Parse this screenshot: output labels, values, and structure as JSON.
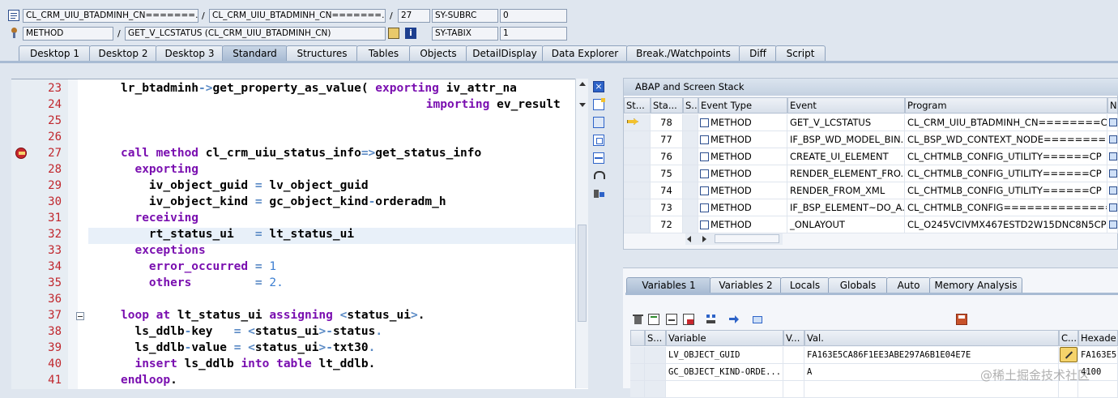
{
  "header": {
    "row1": {
      "program": "CL_CRM_UIU_BTADMINH_CN=======...",
      "include": "CL_CRM_UIU_BTADMINH_CN=======...",
      "line": "27",
      "sysfield": "SY-SUBRC",
      "sysvalue": "0"
    },
    "row2": {
      "event_type": "METHOD",
      "event": "GET_V_LCSTATUS (CL_CRM_UIU_BTADMINH_CN)",
      "sysfield": "SY-TABIX",
      "sysvalue": "1"
    },
    "separator": "/"
  },
  "tabs": [
    "Desktop 1",
    "Desktop 2",
    "Desktop 3",
    "Standard",
    "Structures",
    "Tables",
    "Objects",
    "DetailDisplay",
    "Data Explorer",
    "Break./Watchpoints",
    "Diff",
    "Script"
  ],
  "active_tab": "Standard",
  "code": {
    "lines": [
      {
        "n": "23",
        "segs": [
          [
            "lr_btadminh",
            ""
          ],
          [
            "->",
            "op"
          ],
          [
            "get_property_as_value( ",
            ""
          ],
          [
            "exporting",
            "kw"
          ],
          [
            " iv_attr_na",
            ""
          ]
        ]
      },
      {
        "n": "24",
        "segs": [
          [
            "                       ",
            ""
          ],
          [
            "importing",
            "kw"
          ],
          [
            " ev_result",
            ""
          ]
        ]
      },
      {
        "n": "25",
        "segs": []
      },
      {
        "n": "26",
        "segs": []
      },
      {
        "n": "27",
        "segs": [
          [
            "call method",
            "kw"
          ],
          [
            " cl_crm_uiu_status_info",
            ""
          ],
          [
            "=>",
            "op"
          ],
          [
            "get_status_info",
            ""
          ]
        ]
      },
      {
        "n": "28",
        "segs": [
          [
            "  ",
            ""
          ],
          [
            "exporting",
            "kw"
          ]
        ]
      },
      {
        "n": "29",
        "segs": [
          [
            "    iv_object_guid ",
            ""
          ],
          [
            "=",
            "op"
          ],
          [
            " lv_object_guid",
            ""
          ]
        ]
      },
      {
        "n": "30",
        "segs": [
          [
            "    iv_object_kind ",
            ""
          ],
          [
            "=",
            "op"
          ],
          [
            " gc_object_kind",
            ""
          ],
          [
            "-",
            "op"
          ],
          [
            "orderadm_h",
            ""
          ]
        ]
      },
      {
        "n": "31",
        "segs": [
          [
            "  ",
            ""
          ],
          [
            "receiving",
            "kw"
          ]
        ]
      },
      {
        "n": "32",
        "segs": [
          [
            "    rt_status_ui   ",
            ""
          ],
          [
            "=",
            "op"
          ],
          [
            " lt_status_ui",
            ""
          ]
        ]
      },
      {
        "n": "33",
        "segs": [
          [
            "  ",
            ""
          ],
          [
            "exceptions",
            "kw"
          ]
        ]
      },
      {
        "n": "34",
        "segs": [
          [
            "    ",
            ""
          ],
          [
            "error_occurred",
            "kw"
          ],
          [
            " ",
            ""
          ],
          [
            "=",
            "op"
          ],
          [
            " ",
            ""
          ],
          [
            "1",
            "num"
          ]
        ]
      },
      {
        "n": "35",
        "segs": [
          [
            "    ",
            ""
          ],
          [
            "others",
            "kw"
          ],
          [
            "         ",
            ""
          ],
          [
            "=",
            "op"
          ],
          [
            " ",
            ""
          ],
          [
            "2.",
            "num"
          ]
        ]
      },
      {
        "n": "36",
        "segs": []
      },
      {
        "n": "37",
        "segs": [
          [
            "loop at",
            "kw"
          ],
          [
            " lt_status_ui ",
            ""
          ],
          [
            "assigning",
            "kw"
          ],
          [
            " ",
            ""
          ],
          [
            "<",
            "op"
          ],
          [
            "status_ui",
            ""
          ],
          [
            ">",
            "op"
          ],
          [
            ".",
            ""
          ]
        ]
      },
      {
        "n": "38",
        "segs": [
          [
            "  ls_ddlb",
            ""
          ],
          [
            "-",
            "op"
          ],
          [
            "key   ",
            ""
          ],
          [
            "=",
            "op"
          ],
          [
            " ",
            ""
          ],
          [
            "<",
            "op"
          ],
          [
            "status_ui",
            ""
          ],
          [
            ">",
            "op"
          ],
          [
            "-",
            "op"
          ],
          [
            "status",
            ""
          ],
          [
            ".",
            "op"
          ]
        ]
      },
      {
        "n": "39",
        "segs": [
          [
            "  ls_ddlb",
            ""
          ],
          [
            "-",
            "op"
          ],
          [
            "value ",
            ""
          ],
          [
            "=",
            "op"
          ],
          [
            " ",
            ""
          ],
          [
            "<",
            "op"
          ],
          [
            "status_ui",
            ""
          ],
          [
            ">",
            "op"
          ],
          [
            "-",
            "op"
          ],
          [
            "txt30",
            ""
          ],
          [
            ".",
            "op"
          ]
        ]
      },
      {
        "n": "40",
        "segs": [
          [
            "  ",
            ""
          ],
          [
            "insert",
            "kw"
          ],
          [
            " ls_ddlb ",
            ""
          ],
          [
            "into table",
            "kw"
          ],
          [
            " lt_ddlb.",
            ""
          ]
        ]
      },
      {
        "n": "41",
        "segs": [
          [
            "endloop",
            "kw"
          ],
          [
            ".",
            ""
          ]
        ]
      }
    ]
  },
  "stack": {
    "title": "ABAP and Screen Stack",
    "columns": [
      "St...",
      "Sta...",
      "S...",
      "Event Type",
      "Event",
      "Program",
      "Na"
    ],
    "rows": [
      {
        "level": "78",
        "type": "METHOD",
        "event": "GET_V_LCSTATUS",
        "program": "CL_CRM_UIU_BTADMINH_CN========CP",
        "current": true
      },
      {
        "level": "77",
        "type": "METHOD",
        "event": "IF_BSP_WD_MODEL_BIN...",
        "program": "CL_BSP_WD_CONTEXT_NODE=========CP",
        "current": false
      },
      {
        "level": "76",
        "type": "METHOD",
        "event": "CREATE_UI_ELEMENT",
        "program": "CL_CHTMLB_CONFIG_UTILITY======CP",
        "current": false
      },
      {
        "level": "75",
        "type": "METHOD",
        "event": "RENDER_ELEMENT_FRO...",
        "program": "CL_CHTMLB_CONFIG_UTILITY======CP",
        "current": false
      },
      {
        "level": "74",
        "type": "METHOD",
        "event": "RENDER_FROM_XML",
        "program": "CL_CHTMLB_CONFIG_UTILITY======CP",
        "current": false
      },
      {
        "level": "73",
        "type": "METHOD",
        "event": "IF_BSP_ELEMENT~DO_A...",
        "program": "CL_CHTMLB_CONFIG==============CP",
        "current": false
      },
      {
        "level": "72",
        "type": "METHOD",
        "event": "_ONLAYOUT",
        "program": "CL_O245VCIVMX467ESTD2W15DNC8N5CP",
        "current": false
      }
    ]
  },
  "variables": {
    "tabs": [
      "Variables 1",
      "Variables 2",
      "Locals",
      "Globals",
      "Auto",
      "Memory Analysis"
    ],
    "active_tab": "Variables 1",
    "columns": [
      "S...",
      "Variable",
      "V...",
      "Val.",
      "C...",
      "Hexade"
    ],
    "rows": [
      {
        "variable": "LV_OBJECT_GUID",
        "value": "FA163E5CA86F1EE3ABE297A6B1E04E7E",
        "hex": "FA163E5"
      },
      {
        "variable": "GC_OBJECT_KIND-ORDE...",
        "value": "A",
        "hex": "4100"
      }
    ]
  },
  "watermark": "@稀土掘金技术社区"
}
